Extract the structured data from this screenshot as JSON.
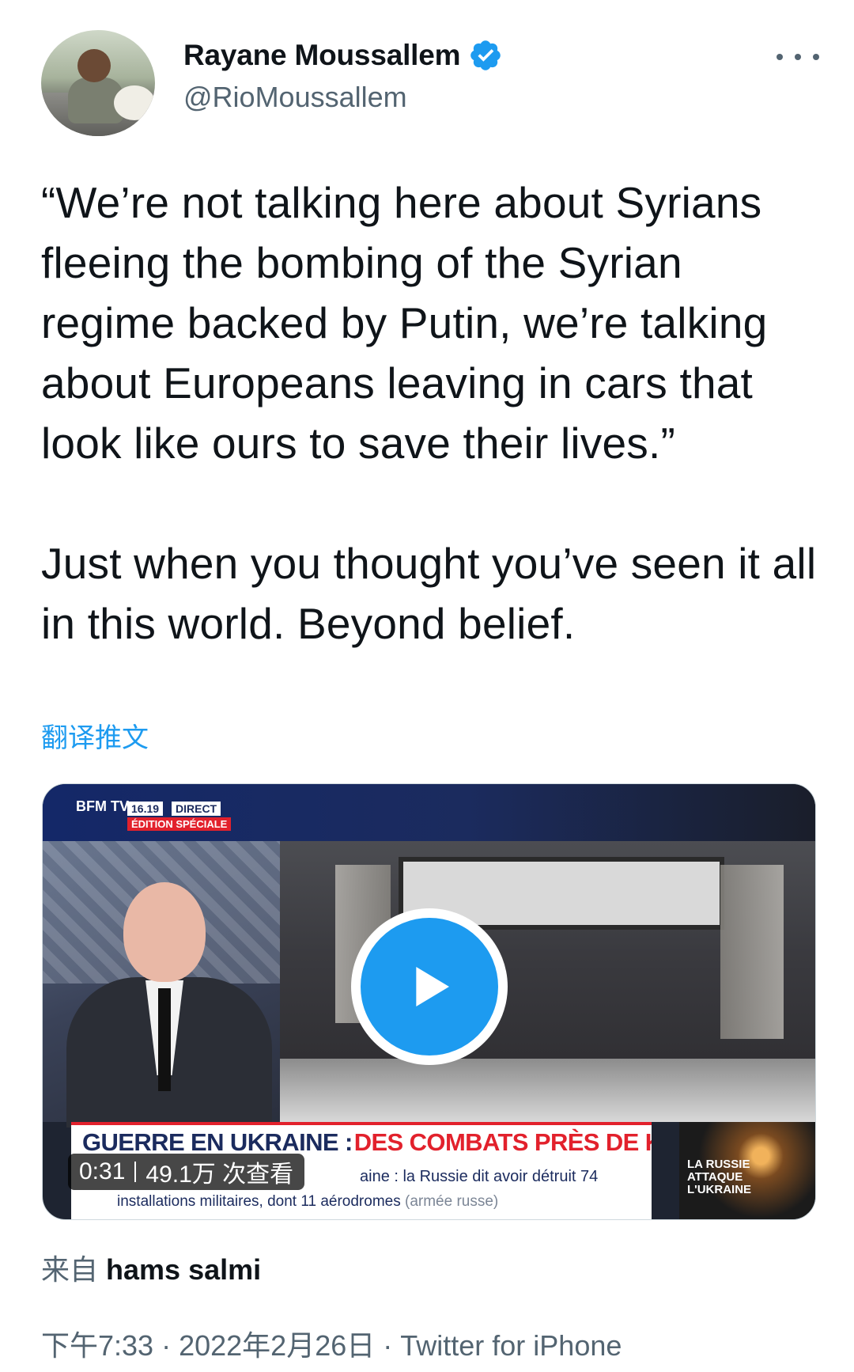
{
  "author": {
    "name": "Rayane Moussallem",
    "handle": "@RioMoussallem",
    "verified": true
  },
  "tweet": {
    "paragraph1": "“We’re not talking here about Syrians fleeing the bombing of the Syrian regime backed by Putin, we’re talking about Europeans leaving in cars that look like ours to save their lives.”",
    "paragraph2": "Just when you thought you’ve seen it all in this world. Beyond belief.",
    "translate_label": "翻译推文"
  },
  "video": {
    "channel": "BFM TV.",
    "time": "16.19",
    "live_label": "DIRECT",
    "edition_label": "ÉDITION SPÉCIALE",
    "banner_part1": "GUERRE EN UKRAINE :",
    "banner_part2": "DES COMBATS PRÈS DE KIEV",
    "ticker_line1": "aine : la Russie dit avoir détruit 74",
    "ticker_line2": "installations militaires, dont 11 aérodromes",
    "ticker_line2_muted": "(armée russe)",
    "corner_text": "LA RUSSIE\nATTAQUE\nL'UKRAINE",
    "duration": "0:31",
    "views": "49.1万 次查看"
  },
  "source": {
    "prefix": "来自",
    "name": "hams salmi"
  },
  "meta": {
    "time": "下午7:33",
    "date": "2022年2月26日",
    "client": "Twitter for iPhone"
  },
  "colors": {
    "accent": "#1d9bf0",
    "text": "#0f1419",
    "secondary": "#536471"
  }
}
